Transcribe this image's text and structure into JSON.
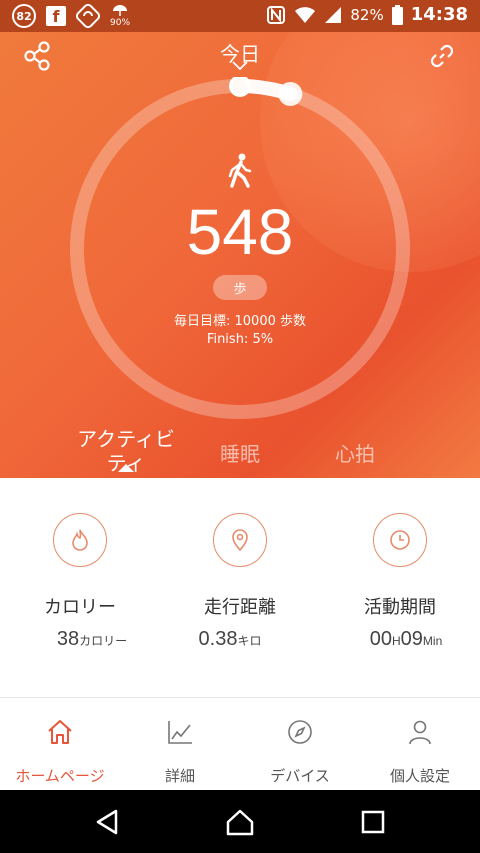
{
  "status_bar": {
    "badge": "82",
    "facebook": "f",
    "weather": "90%",
    "battery": "82%",
    "time": "14:38"
  },
  "header": {
    "title": "今日",
    "share_icon": "share-icon",
    "link_icon": "link-icon"
  },
  "activity": {
    "steps": "548",
    "unit": "歩",
    "goal_text": "毎日目標: 10000 歩数",
    "finish_text": "Finish: 5%",
    "progress_fraction": 0.05
  },
  "tabs": [
    {
      "label": "アクティビ\nティ",
      "active": true
    },
    {
      "label": "睡眠",
      "active": false
    },
    {
      "label": "心拍",
      "active": false
    }
  ],
  "stats": [
    {
      "icon": "flame-icon",
      "label": "カロリー",
      "value": "38",
      "unit": "カロリー"
    },
    {
      "icon": "location-pin-icon",
      "label": "走行距離",
      "value": "0.38",
      "unit": "キロ"
    },
    {
      "icon": "clock-icon",
      "label": "活動期間",
      "value_h": "00",
      "unit_h": "H",
      "value_m": "09",
      "unit_m": "Min"
    }
  ],
  "bottom_nav": [
    {
      "icon": "home-icon",
      "label": "ホームページ",
      "active": true
    },
    {
      "icon": "chart-icon",
      "label": "詳細",
      "active": false
    },
    {
      "icon": "compass-icon",
      "label": "デバイス",
      "active": false
    },
    {
      "icon": "person-icon",
      "label": "個人設定",
      "active": false
    }
  ],
  "colors": {
    "accent": "#e8553a",
    "hero_start": "#f07a3c",
    "hero_end": "#e9522e"
  }
}
